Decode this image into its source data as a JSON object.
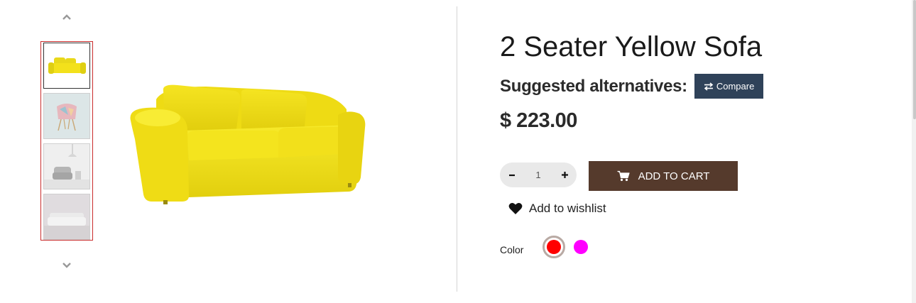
{
  "product": {
    "title": "2 Seater Yellow Sofa",
    "alternatives_label": "Suggested alternatives:",
    "compare_label": "Compare",
    "price": "$ 223.00"
  },
  "gallery": {
    "thumbnails": [
      {
        "name": "yellow-sofa",
        "active": true
      },
      {
        "name": "patterned-chair",
        "active": false
      },
      {
        "name": "grey-armchair-lamp",
        "active": false
      },
      {
        "name": "grey-sofa",
        "active": false
      }
    ],
    "icons": {
      "up": "chevron-up-icon",
      "down": "chevron-down-icon"
    }
  },
  "cart": {
    "quantity": "1",
    "minus_icon": "minus-icon",
    "plus_icon": "plus-icon",
    "add_to_cart_label": "ADD TO CART"
  },
  "wishlist": {
    "label": "Add to wishlist"
  },
  "color": {
    "label": "Color",
    "options": [
      {
        "value": "#ff0000",
        "selected": true
      },
      {
        "value": "#ff00ff",
        "selected": false
      }
    ]
  },
  "colors": {
    "compare_bg": "#2f4259",
    "cart_bg": "#553a2c",
    "thumb_border": "#c92c2c",
    "sofa_yellow": "#f3e11b"
  }
}
